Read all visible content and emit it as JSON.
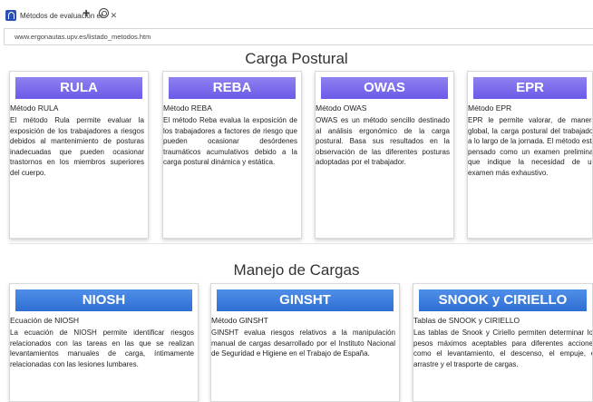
{
  "browser": {
    "tab_title": "Métodos de evaluación er",
    "tab_close": "✕",
    "new_tab": "+",
    "url": "www.ergonautas.upv.es/listado_metodos.htm"
  },
  "sections": [
    {
      "title": "Carga Postural",
      "cards": [
        {
          "head": "RULA",
          "sub": "Método RULA",
          "desc": "El método Rula permite evaluar la exposición de los trabajadores a riesgos debidos al mantenimiento de posturas inadecuadas que pueden ocasionar trastornos en los miembros superiores del cuerpo."
        },
        {
          "head": "REBA",
          "sub": "Método REBA",
          "desc": "El método Reba evalua la exposición de los trabajadores a factores de riesgo que pueden ocasionar desórdenes traumáticos acumulativos debido a la carga postural dinámica y estática."
        },
        {
          "head": "OWAS",
          "sub": "Método OWAS",
          "desc": "OWAS es un método sencillo destinado al análisis ergonómico de la carga postural. Basa sus resultados en la observación de las diferentes posturas adoptadas por el trabajador."
        },
        {
          "head": "EPR",
          "sub": "Método EPR",
          "desc": "EPR le permite valorar, de manera global, la carga postural del trabajador a lo largo de la jornada. El método está pensado como un examen preliminar que indique la necesidad de un examen más exhaustivo."
        }
      ]
    },
    {
      "title": "Manejo de Cargas",
      "cards": [
        {
          "head": "NIOSH",
          "sub": "Ecuación de NIOSH",
          "desc": "La ecuación de NIOSH permite identificar riesgos relacionados con las tareas en las que se realizan levantamientos manuales de carga, íntimamente relacionadas con las lesiones lumbares."
        },
        {
          "head": "GINSHT",
          "sub": "Método GINSHT",
          "desc": "GINSHT evalua riesgos relativos a la manipulación manual de cargas desarrollado por el Instituto Nacional de Seguridad e Higiene en el Trabajo de España."
        },
        {
          "head": "SNOOK y CIRIELLO",
          "sub": "Tablas de SNOOK y CIRIELLO",
          "desc": "Las tablas de Snook y Ciriello permiten determinar los pesos máximos aceptables para diferentes acciones como el levantamiento, el descenso, el empuje, el arrastre y el trasporte de cargas."
        }
      ]
    }
  ],
  "colors": {
    "postural_header": "#7a6cec",
    "cargas_header": "#3a7ddc"
  }
}
